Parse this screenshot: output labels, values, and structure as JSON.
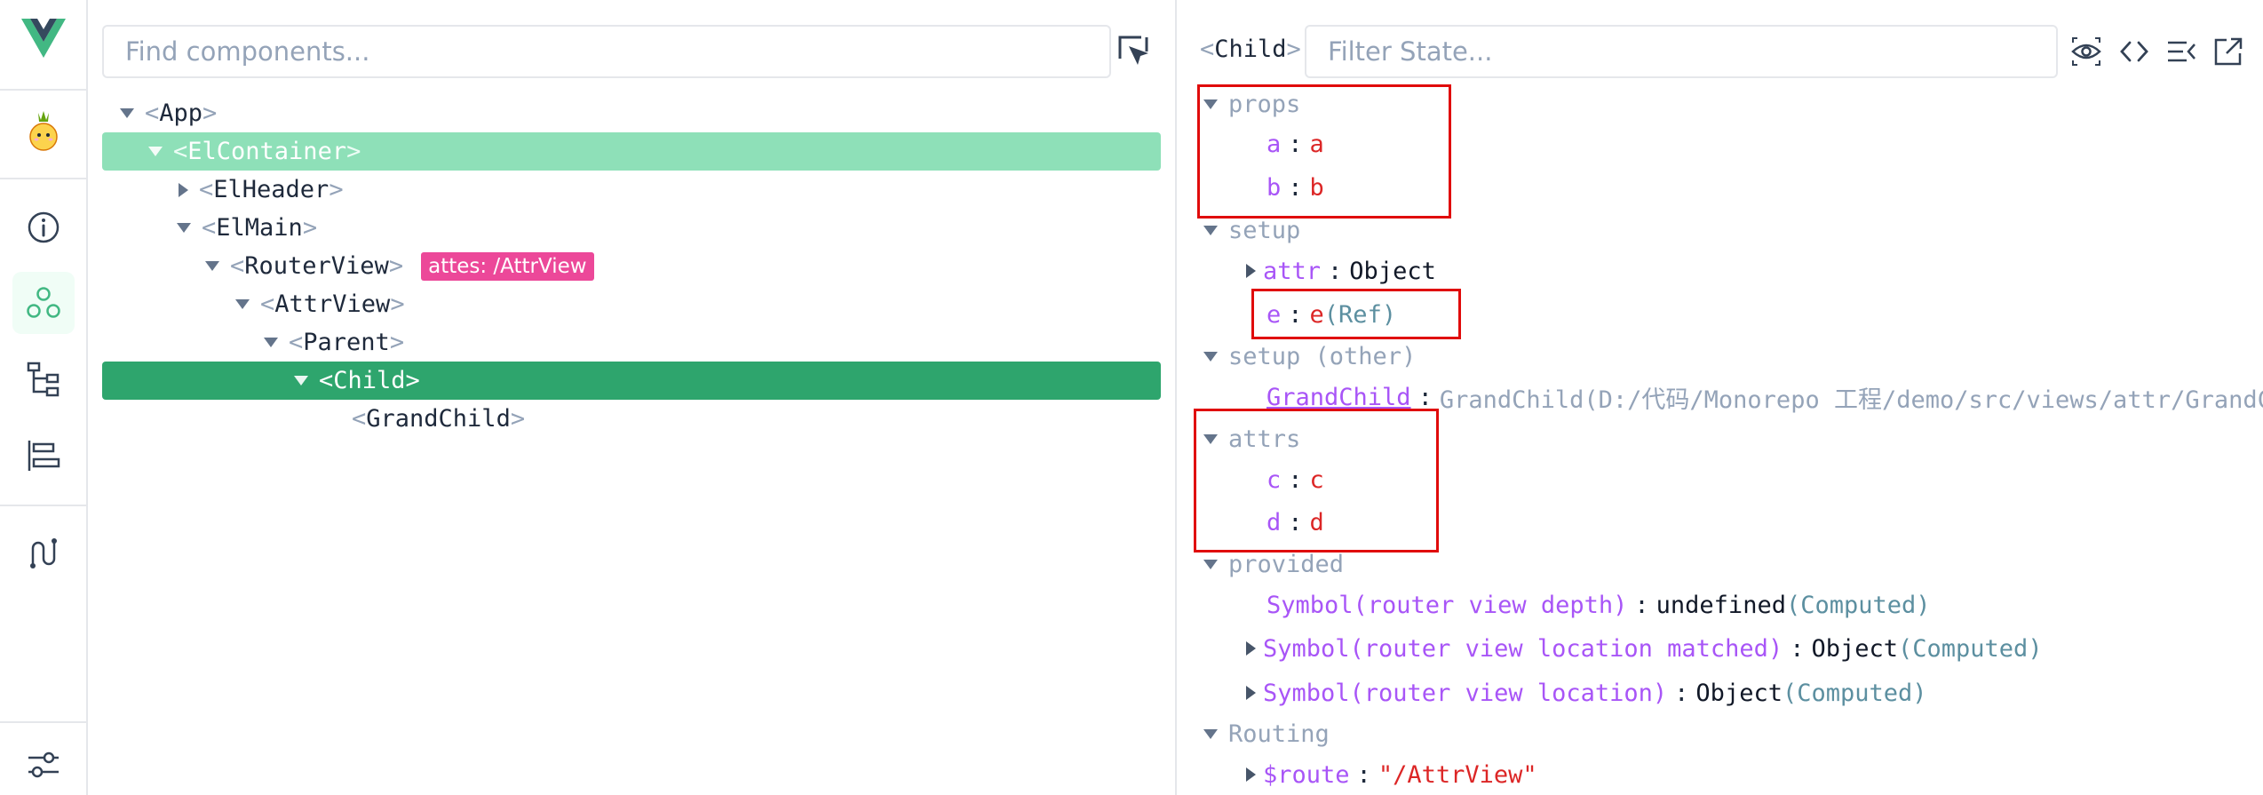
{
  "tree": {
    "search_placeholder": "Find components...",
    "rows": [
      {
        "name": "App"
      },
      {
        "name": "ElContainer"
      },
      {
        "name": "ElHeader"
      },
      {
        "name": "ElMain"
      },
      {
        "name": "RouterView",
        "badge": "attes: /AttrView"
      },
      {
        "name": "AttrView"
      },
      {
        "name": "Parent"
      },
      {
        "name": "Child"
      },
      {
        "name": "GrandChild"
      }
    ]
  },
  "inspector": {
    "selected_component": "Child",
    "filter_placeholder": "Filter State...",
    "brackets": {
      "open": "<",
      "close": ">"
    },
    "sections": {
      "props": "props",
      "setup": "setup",
      "setup_other": "setup (other)",
      "attrs": "attrs",
      "provided": "provided",
      "routing": "Routing"
    },
    "props": [
      {
        "key": "a",
        "value": "a"
      },
      {
        "key": "b",
        "value": "b"
      }
    ],
    "setup": [
      {
        "key": "attr",
        "value": "Object"
      },
      {
        "key": "e",
        "value": "e",
        "note": "(Ref)"
      }
    ],
    "setup_other": [
      {
        "key": "GrandChild",
        "value": "GrandChild(D:/代码/Monorepo 工程/demo/src/views/attr/GrandC"
      }
    ],
    "attrs": [
      {
        "key": "c",
        "value": "c"
      },
      {
        "key": "d",
        "value": "d"
      }
    ],
    "provided": [
      {
        "key": "Symbol(router view depth)",
        "value": "undefined",
        "note": "(Computed)"
      },
      {
        "key": "Symbol(router view location matched)",
        "value": "Object",
        "note": "(Computed)"
      },
      {
        "key": "Symbol(router view location)",
        "value": "Object",
        "note": "(Computed)"
      }
    ],
    "routing": [
      {
        "key": "$route",
        "value": "\"/AttrView\""
      }
    ]
  },
  "colors": {
    "vue_green": "#42b883",
    "selected_row": "#2ea56d",
    "hover_row": "#8ee0b8",
    "badge": "#ec4899",
    "highlight_box": "#e00b0b"
  },
  "icons": [
    "vue-logo-icon",
    "pinia-icon",
    "info-icon",
    "components-icon",
    "tree-icon",
    "timeline-icon",
    "router-icon",
    "settings-icon",
    "pick-element-icon",
    "eye-icon",
    "code-icon",
    "collapse-icon",
    "open-external-icon"
  ]
}
